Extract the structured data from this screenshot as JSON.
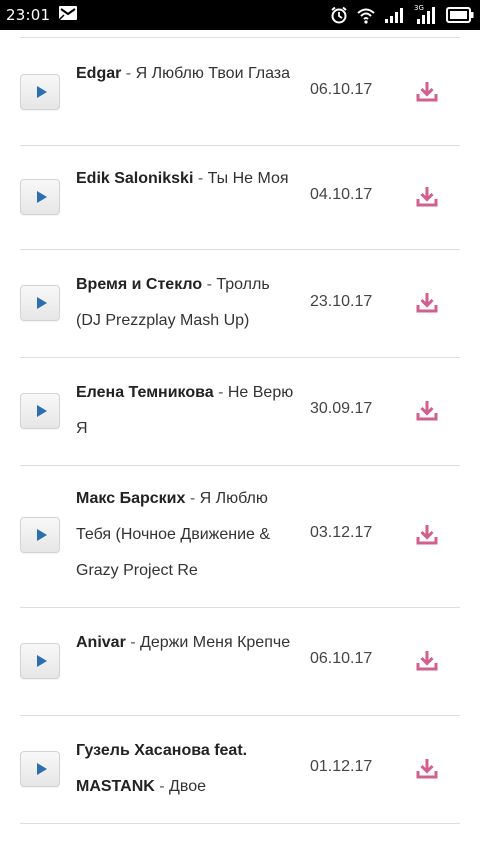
{
  "status_bar": {
    "time": "23:01",
    "icons": [
      "message-icon",
      "alarm-icon",
      "wifi-icon",
      "signal-icon",
      "signal-3g-icon",
      "battery-icon"
    ],
    "network_label": "3G"
  },
  "colors": {
    "accent_download": "#d2608f",
    "play_icon": "#2a6fb0",
    "divider": "#dedede"
  },
  "tracks": [
    {
      "artist": "Edgar",
      "sep": " - ",
      "title": "Я Люблю Твои Глаза",
      "date": "06.10.17"
    },
    {
      "artist": "Edik Salonikski",
      "sep": " - ",
      "title": "Ты Не Моя",
      "date": "04.10.17"
    },
    {
      "artist": "Время и Стекло",
      "sep": " - ",
      "title": "Тролль (DJ Prezzplay Mash Up)",
      "date": "23.10.17"
    },
    {
      "artist": "Елена Темникова",
      "sep": " - ",
      "title": "Не Верю Я",
      "date": "30.09.17"
    },
    {
      "artist": "Макс Барских",
      "sep": " - ",
      "title": "Я Люблю Тебя (Ночное Движение & Grazy Project Re",
      "date": "03.12.17"
    },
    {
      "artist": "Anivar",
      "sep": " - ",
      "title": "Держи Меня Крепче",
      "date": "06.10.17"
    },
    {
      "artist": "Гузель Хасанова feat. MASTANK",
      "sep": " - ",
      "title": "Двое",
      "date": "01.12.17"
    }
  ]
}
